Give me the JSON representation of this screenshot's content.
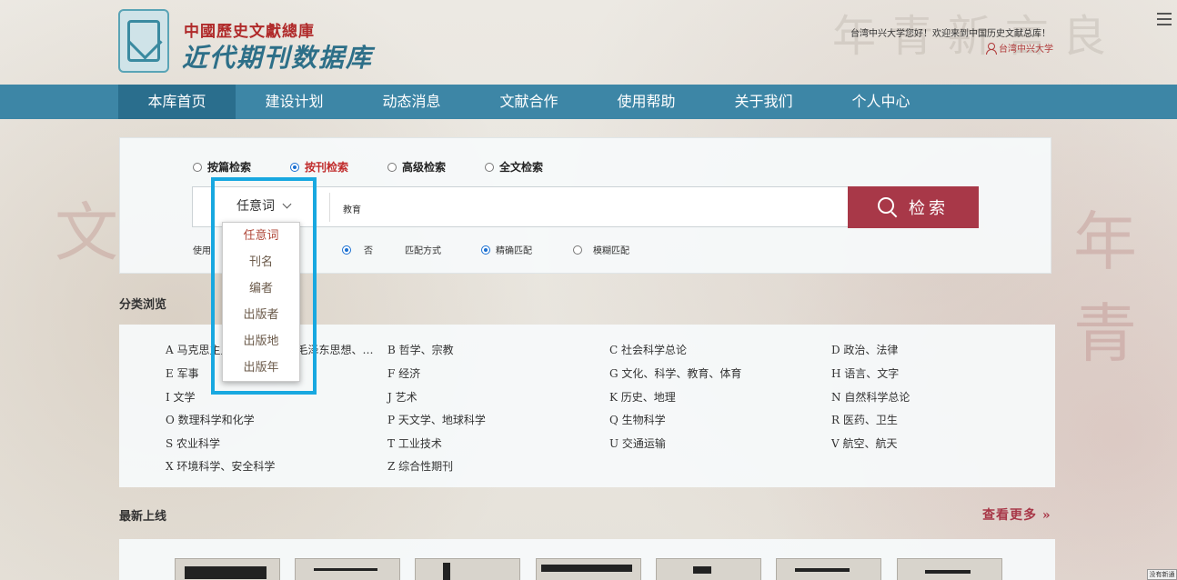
{
  "header": {
    "logo_line1": "中國歷史文獻總庫",
    "logo_line2": "近代期刊数据库",
    "welcome": "台湾中兴大学您好！欢迎来到中国历史文献总库！",
    "user": "台湾中兴大学"
  },
  "nav": [
    "本库首页",
    "建设计划",
    "动态消息",
    "文献合作",
    "使用帮助",
    "关于我们",
    "个人中心"
  ],
  "search": {
    "modes": [
      "按篇检索",
      "按刊检索",
      "高级检索",
      "全文检索"
    ],
    "selected_mode": "按刊检索",
    "field_selected": "任意词",
    "query": "教育",
    "button": "检索",
    "dropdown_options": [
      "任意词",
      "刊名",
      "编者",
      "出版者",
      "出版地",
      "出版年"
    ],
    "option_row": {
      "use_label": "使用",
      "no_label": "否",
      "match_label": "匹配方式",
      "exact": "精确匹配",
      "fuzzy": "模糊匹配"
    }
  },
  "categories": {
    "title": "分类浏览",
    "items": [
      "A 马克思主义、列宁主义、毛泽东思想、…",
      "B 哲学、宗教",
      "C 社会科学总论",
      "D 政治、法律",
      "E 军事",
      "F 经济",
      "G 文化、科学、教育、体育",
      "H 语言、文字",
      "I 文学",
      "J 艺术",
      "K 历史、地理",
      "N 自然科学总论",
      "O 数理科学和化学",
      "P 天文学、地球科学",
      "Q 生物科学",
      "R 医药、卫生",
      "S 农业科学",
      "T 工业技术",
      "U 交通运输",
      "V 航空、航天",
      "X 环境科学、安全科学",
      "Z 综合性期刊"
    ]
  },
  "latest": {
    "title": "最新上线",
    "more": "查看更多 »"
  },
  "corner_tag": "没有新通"
}
